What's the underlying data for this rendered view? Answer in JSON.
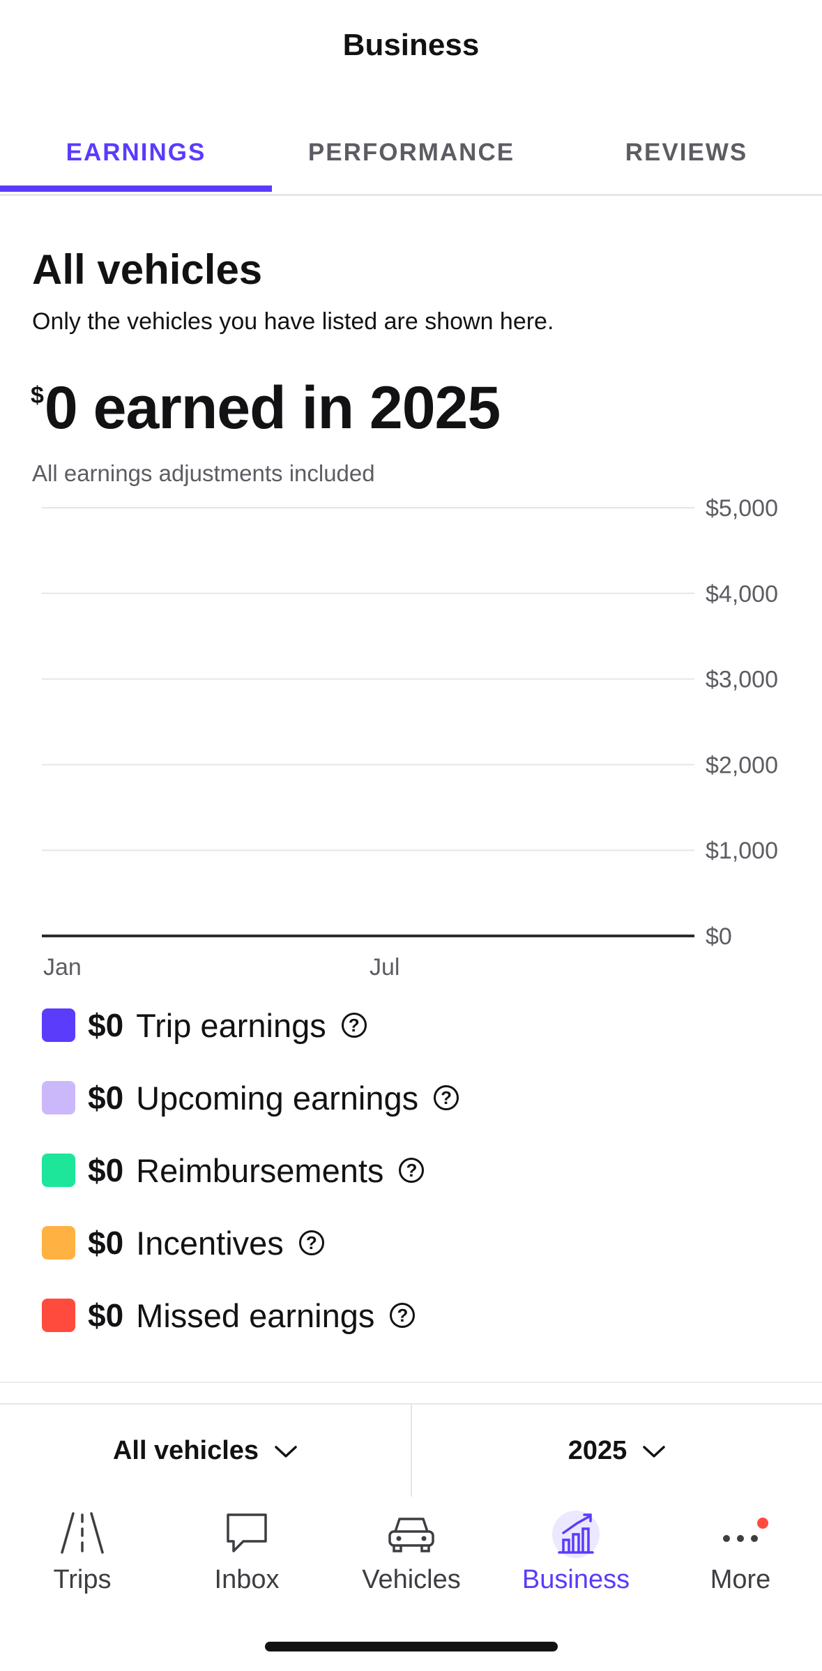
{
  "header": {
    "title": "Business"
  },
  "tabs": [
    {
      "label": "EARNINGS",
      "active": true
    },
    {
      "label": "PERFORMANCE",
      "active": false
    },
    {
      "label": "REVIEWS",
      "active": false
    }
  ],
  "summary": {
    "title": "All vehicles",
    "subtitle": "Only the vehicles you have listed are shown here.",
    "currency_symbol": "$",
    "earned_text": "0 earned in 2025",
    "adjustments_note": "All earnings adjustments included"
  },
  "chart_data": {
    "type": "bar",
    "x_tick_labels": [
      "Jan",
      "Jul"
    ],
    "y_ticks": [
      0,
      1000,
      2000,
      3000,
      4000,
      5000
    ],
    "y_tick_labels": [
      "$0",
      "$1,000",
      "$2,000",
      "$3,000",
      "$4,000",
      "$5,000"
    ],
    "ylim": [
      0,
      5000
    ],
    "y_axis_side": "right",
    "grid": true,
    "series": [
      {
        "name": "Trip earnings",
        "values": []
      }
    ]
  },
  "legend": [
    {
      "amount": "$0",
      "label": "Trip earnings",
      "color": "#5b3cfb",
      "help_icon": "question-circle-icon"
    },
    {
      "amount": "$0",
      "label": "Upcoming earnings",
      "color": "#cbb8fa",
      "help_icon": "question-circle-icon"
    },
    {
      "amount": "$0",
      "label": "Reimbursements",
      "color": "#1de59a",
      "help_icon": "question-circle-icon"
    },
    {
      "amount": "$0",
      "label": "Incentives",
      "color": "#ffb142",
      "help_icon": "question-circle-icon"
    },
    {
      "amount": "$0",
      "label": "Missed earnings",
      "color": "#ff4b3e",
      "help_icon": "question-circle-icon"
    }
  ],
  "filters": {
    "vehicle": "All vehicles",
    "year": "2025"
  },
  "bottom_nav": [
    {
      "label": "Trips",
      "icon": "road-icon",
      "active": false
    },
    {
      "label": "Inbox",
      "icon": "chat-bubble-icon",
      "active": false
    },
    {
      "label": "Vehicles",
      "icon": "car-icon",
      "active": false
    },
    {
      "label": "Business",
      "icon": "bar-chart-trend-icon",
      "active": true
    },
    {
      "label": "More",
      "icon": "more-dots-icon",
      "active": false,
      "notification_dot": true
    }
  ],
  "colors": {
    "accent": "#593cfb",
    "notification": "#ff4b3e"
  }
}
